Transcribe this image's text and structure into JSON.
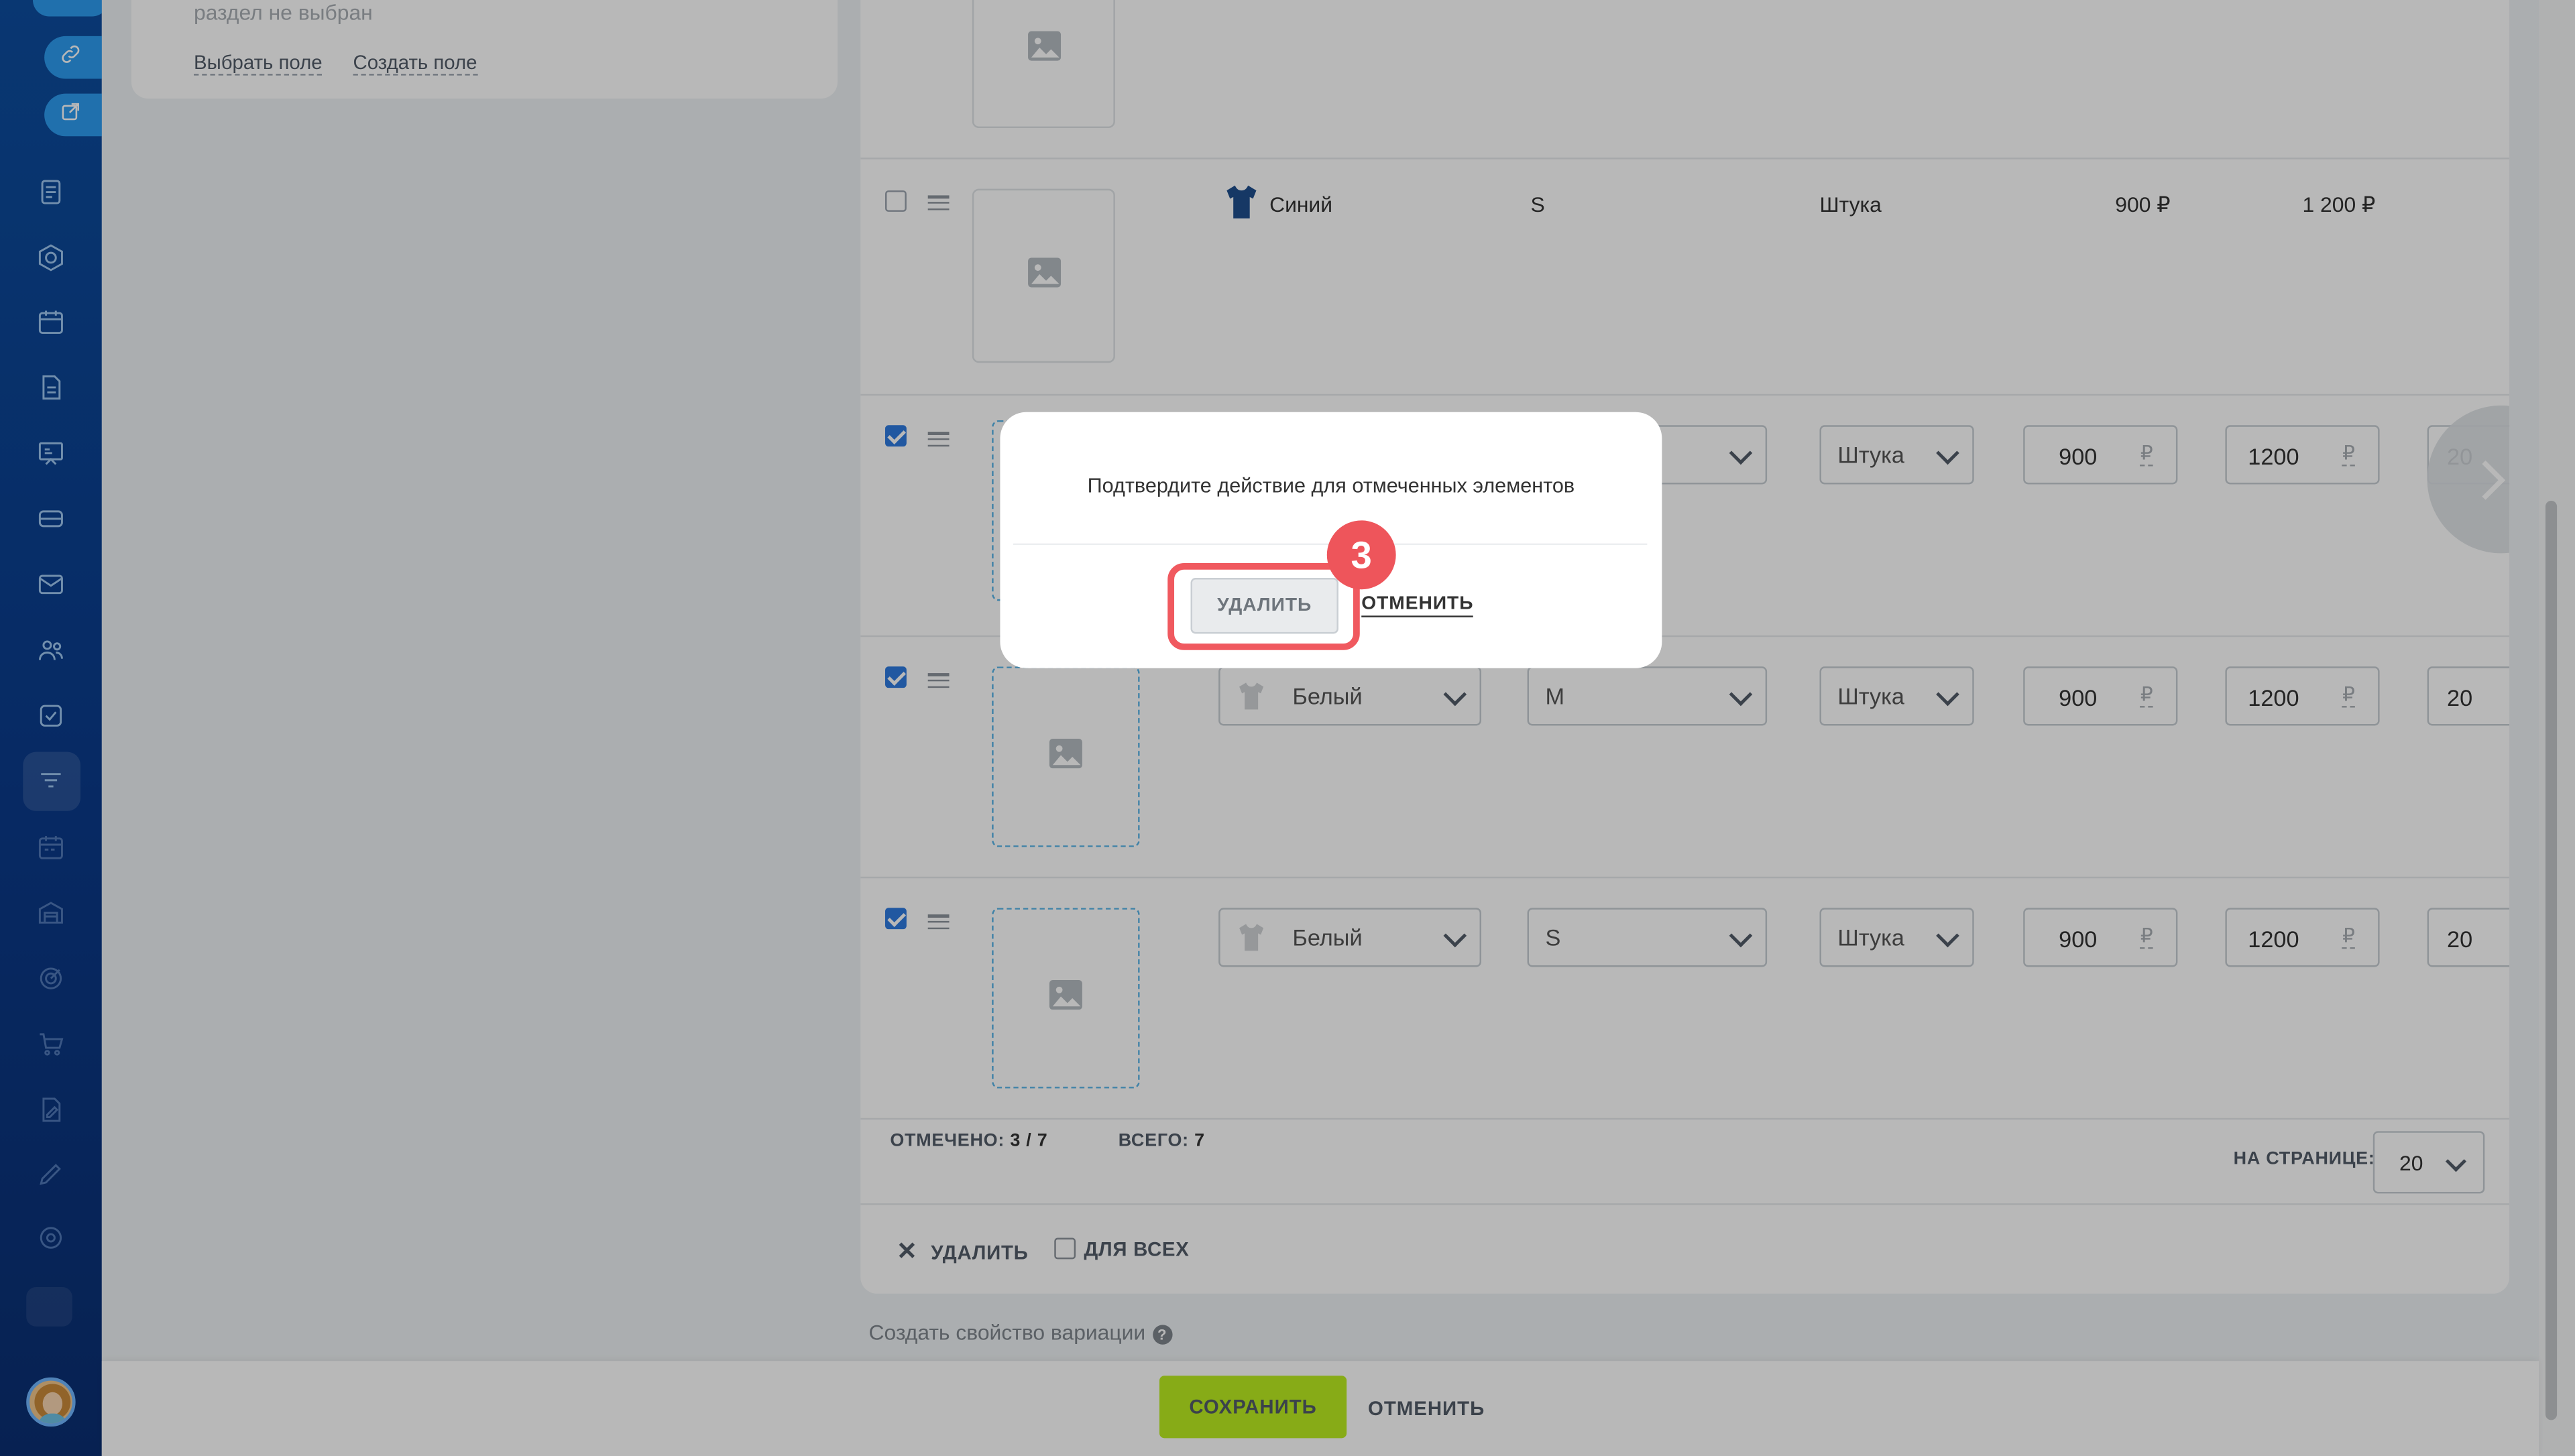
{
  "left_card": {
    "no_section_text": "раздел не выбран",
    "choose_field_link": "Выбрать поле",
    "create_field_link": "Создать поле"
  },
  "rows": [
    {
      "checked": false,
      "color": "Синий",
      "size": "S",
      "unit": "Штука",
      "purchase_price": "900 ₽",
      "price": "1 200 ₽"
    },
    {
      "checked": true,
      "unit": "Штука",
      "purchase_price": "900",
      "price": "1200",
      "qty": "20",
      "currency": "₽"
    },
    {
      "checked": true,
      "color": "Белый",
      "size": "M",
      "unit": "Штука",
      "purchase_price": "900",
      "price": "1200",
      "qty": "20",
      "currency": "₽"
    },
    {
      "checked": true,
      "color": "Белый",
      "size": "S",
      "unit": "Штука",
      "purchase_price": "900",
      "price": "1200",
      "qty": "20",
      "currency": "₽"
    }
  ],
  "grid_footer": {
    "selected_label": "ОТМЕЧЕНО:",
    "selected_value": "3 / 7",
    "total_label": "ВСЕГО:",
    "total_value": "7",
    "per_page_label": "НА СТРАНИЦЕ:",
    "per_page_value": "20"
  },
  "actions": {
    "delete_label": "УДАЛИТЬ",
    "for_all_label": "ДЛЯ ВСЕХ"
  },
  "create_property_link": "Создать свойство вариации",
  "bottom_bar": {
    "save_label": "СОХРАНИТЬ",
    "cancel_label": "ОТМЕНИТЬ"
  },
  "modal": {
    "message": "Подтвердите действие для отмеченных элементов",
    "delete_label": "УДАЛИТЬ",
    "cancel_label": "ОТМЕНИТЬ",
    "step_number": "3"
  },
  "colors": {
    "sidebar": "#0d4d9e",
    "accent_blue": "#2d9cf0",
    "save_green": "#bbed21",
    "highlight_red": "#f0595f",
    "checkbox_blue": "#2f7be0"
  },
  "icons": [
    "link-icon",
    "external-link-icon",
    "document-icon",
    "hexagon-icon",
    "calendar-icon",
    "file-icon",
    "presentation-icon",
    "card-icon",
    "mail-icon",
    "users-icon",
    "checkbox-icon",
    "filter-icon",
    "schedule-icon",
    "warehouse-icon",
    "target-icon",
    "cart-icon",
    "edit-doc-icon",
    "pen-icon",
    "gear-icon",
    "image-placeholder-icon",
    "chevron-right-icon",
    "tshirt-icon",
    "help-icon"
  ]
}
